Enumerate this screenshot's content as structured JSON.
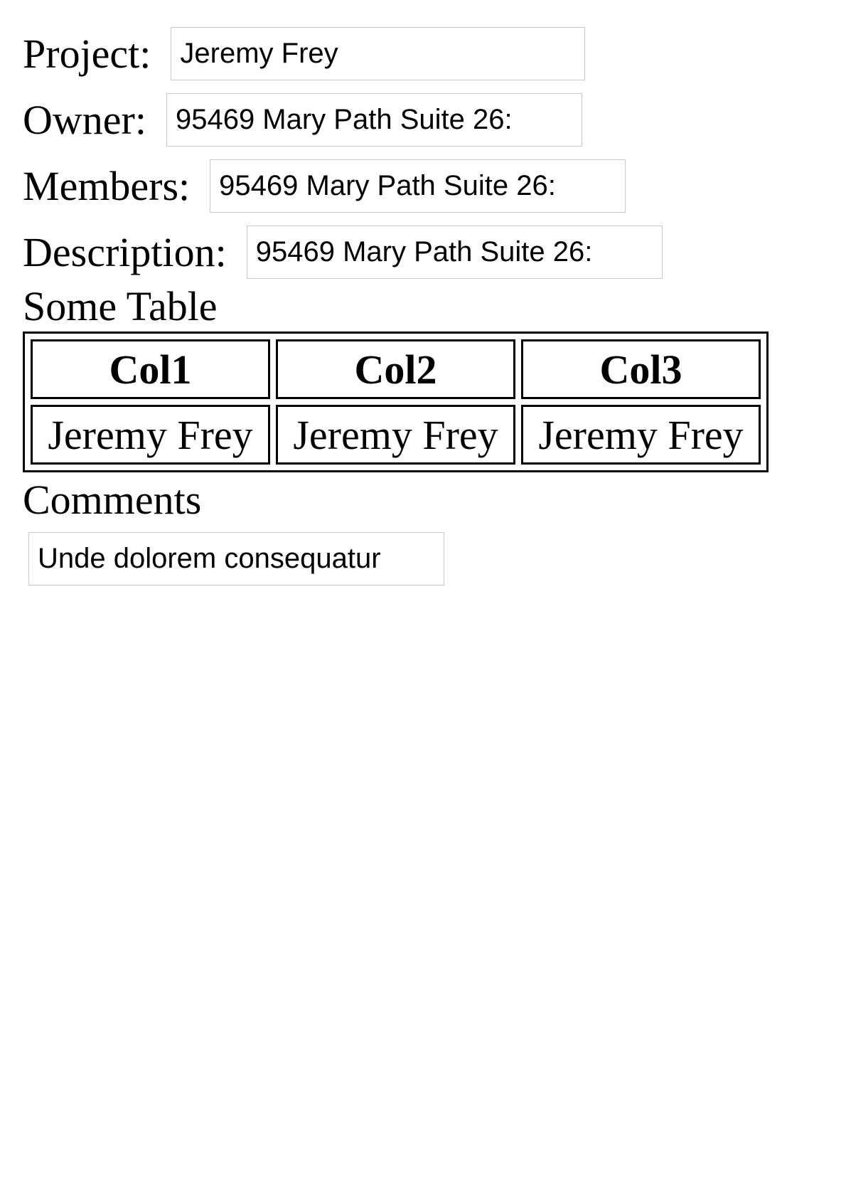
{
  "form": {
    "project_label": "Project:",
    "project_value": "Jeremy Frey",
    "owner_label": "Owner:",
    "owner_value": "95469 Mary Path Suite 26:",
    "members_label": "Members:",
    "members_value": "95469 Mary Path Suite 26:",
    "description_label": "Description:",
    "description_value": "95469 Mary Path Suite 26:"
  },
  "table": {
    "title": "Some Table",
    "headers": [
      "Col1",
      "Col2",
      "Col3"
    ],
    "rows": [
      [
        "Jeremy Frey",
        "Jeremy Frey",
        "Jeremy Frey"
      ]
    ]
  },
  "comments": {
    "title": "Comments",
    "value": "Unde dolorem consequatur"
  }
}
